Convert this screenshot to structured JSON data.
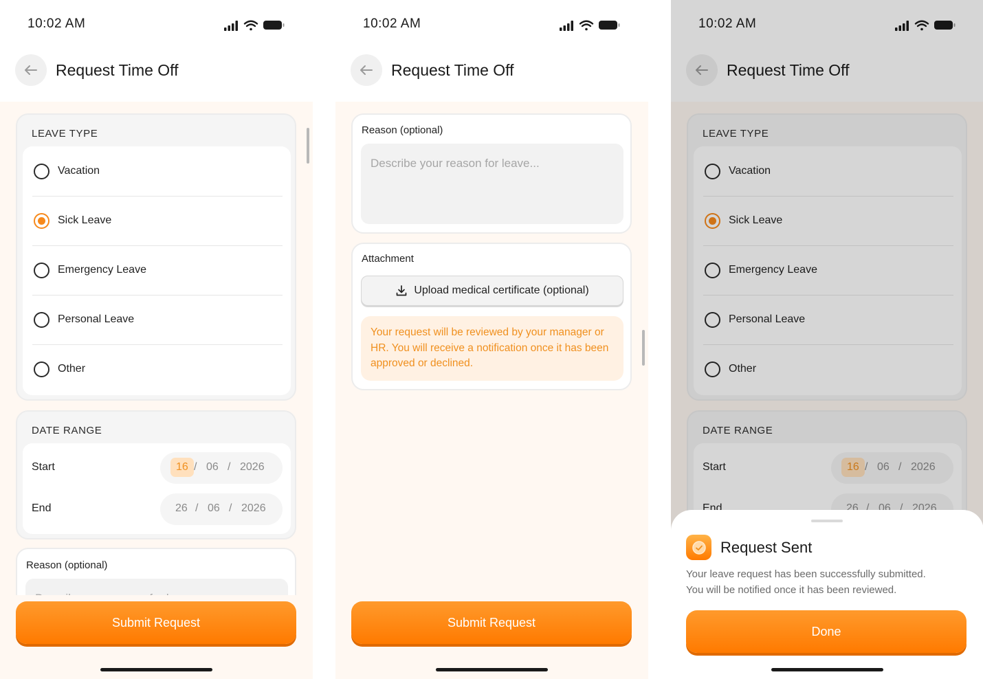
{
  "status": {
    "time": "10:02 AM"
  },
  "header": {
    "title": "Request Time Off"
  },
  "leave_type": {
    "title": "LEAVE TYPE",
    "options": [
      {
        "label": "Vacation",
        "selected": false
      },
      {
        "label": "Sick Leave",
        "selected": true
      },
      {
        "label": "Emergency Leave",
        "selected": false
      },
      {
        "label": "Personal Leave",
        "selected": false
      },
      {
        "label": "Other",
        "selected": false
      }
    ]
  },
  "date_range": {
    "title": "DATE RANGE",
    "start": {
      "label": "Start",
      "day": "16",
      "month": "06",
      "year": "2026"
    },
    "end": {
      "label": "End",
      "day": "26",
      "month": "06",
      "year": "2026"
    },
    "separator": "/"
  },
  "reason": {
    "label": "Reason (optional)",
    "placeholder": "Describe your reason for leave..."
  },
  "attachment": {
    "label": "Attachment",
    "upload_label": "Upload medical certificate (optional)"
  },
  "notice": {
    "text": "Your request will be reviewed by your manager or HR. You will receive a notification once it has been approved or declined."
  },
  "submit_label": "Submit Request",
  "sheet": {
    "title": "Request Sent",
    "message_line1": "Your leave request has been successfully submitted.",
    "message_line2": "You will be notified once it has been reviewed.",
    "done_label": "Done"
  },
  "colors": {
    "accent": "#ff8a00",
    "background": "#fff8f2",
    "notice_bg": "#fff1e3"
  }
}
